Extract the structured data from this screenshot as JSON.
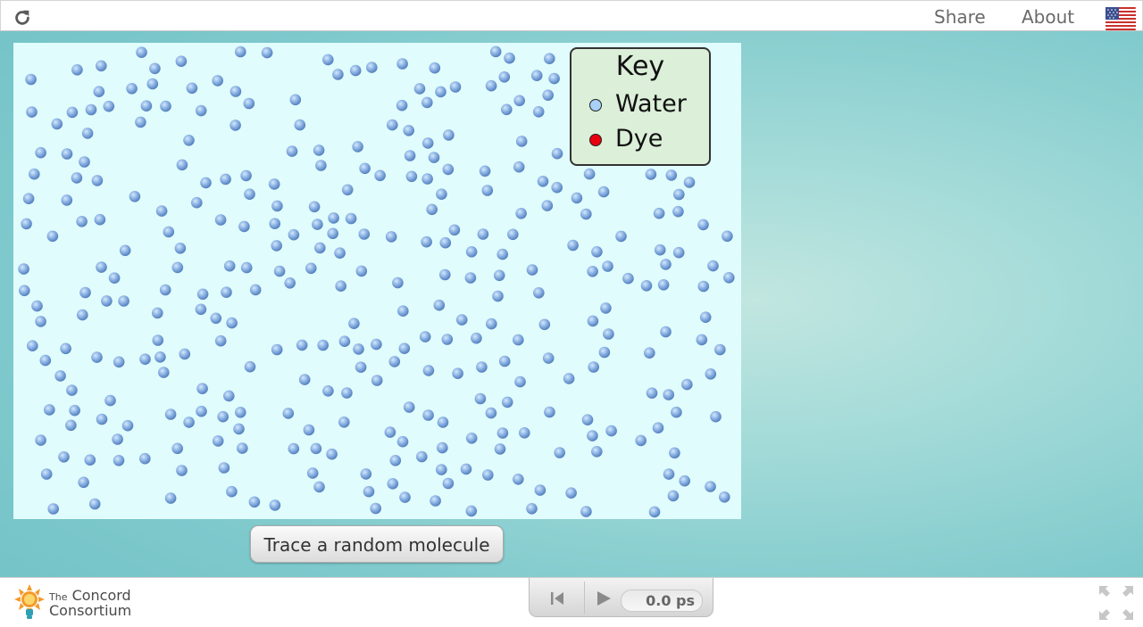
{
  "topbar": {
    "reload_icon": "reload-icon",
    "share_label": "Share",
    "about_label": "About",
    "language_icon": "us-flag-icon"
  },
  "key": {
    "title": "Key",
    "items": [
      {
        "label": "Water",
        "color": "#a9d0f5"
      },
      {
        "label": "Dye",
        "color": "#e8000f"
      }
    ]
  },
  "trace_button": {
    "label": "Trace a random molecule"
  },
  "footer": {
    "logo_line1_small": "The",
    "logo_line1": "Concord",
    "logo_line2": "Consortium",
    "time_display": "0.0 ps",
    "reset_icon": "skip-back-icon",
    "play_icon": "play-icon",
    "fullscreen_icon": "fullscreen-icon"
  },
  "colors": {
    "model_background": "#e0fcfc",
    "water_molecule": "#7fa9dc",
    "key_background": "#dcefd9"
  }
}
